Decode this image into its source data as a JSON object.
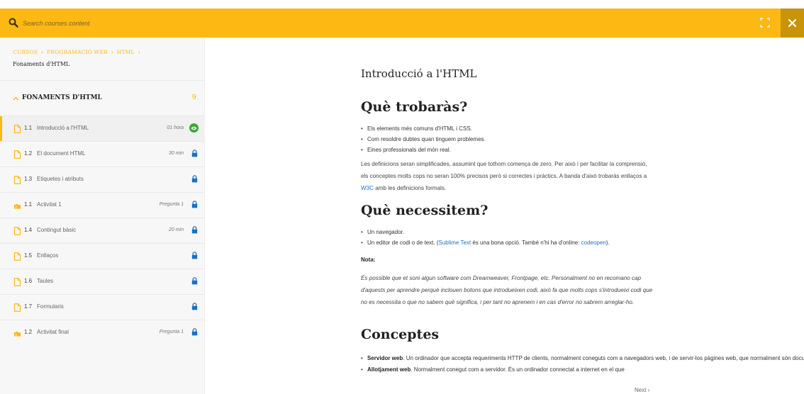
{
  "search": {
    "placeholder": "Search courses content"
  },
  "colors": {
    "accent": "#fdb813",
    "close_bg": "#c9930a",
    "complete": "#3aaa35",
    "link": "#1a73c8"
  },
  "breadcrumb": {
    "items": [
      "CURSOS",
      "PROGRAMACIÓ WEB",
      "HTML"
    ],
    "current": "Fonaments d'HTML"
  },
  "section": {
    "title": "FONAMENTS D'HTML",
    "count": "9"
  },
  "lessons": [
    {
      "type": "doc",
      "num": "1.1",
      "title": "Introducció a l'HTML",
      "meta": "01 hora",
      "status": "viewed",
      "active": true
    },
    {
      "type": "doc",
      "num": "1.2",
      "title": "El document HTML",
      "meta": "30 min",
      "status": "locked"
    },
    {
      "type": "doc",
      "num": "1.3",
      "title": "Etiquetes i atributs",
      "meta": "",
      "status": "locked"
    },
    {
      "type": "quiz",
      "num": "1.1",
      "title": "Activitat 1",
      "meta": "Pregunta 1",
      "status": "locked"
    },
    {
      "type": "doc",
      "num": "1.4",
      "title": "Contingut bàsic",
      "meta": "20 min",
      "status": "locked"
    },
    {
      "type": "doc",
      "num": "1.5",
      "title": "Enllaços",
      "meta": "",
      "status": "locked"
    },
    {
      "type": "doc",
      "num": "1.6",
      "title": "Taules",
      "meta": "",
      "status": "locked"
    },
    {
      "type": "doc",
      "num": "1.7",
      "title": "Formularis",
      "meta": "",
      "status": "locked"
    },
    {
      "type": "quiz",
      "num": "1.2",
      "title": "Activitat final",
      "meta": "Pregunta 1",
      "status": "locked"
    }
  ],
  "content": {
    "title": "Introducció a l'HTML",
    "h_find": "Què trobaràs?",
    "find_items": [
      "Els elements més comuns d'HTML i CSS.",
      "Com resoldre dubtes quan tinguem problemes.",
      "Eines professionals del món real."
    ],
    "find_para_1": "Les definicions seran simplificades, assumint que tothom comença de zero. Per això i per facilitar la comprensió, els conceptes molts cops no seran 100% precisos però si correctes i pràctics. A banda d'això trobaràs enllaços a ",
    "find_para_link": "W3C",
    "find_para_2": " amb les definicions formals.",
    "h_need": "Què necessitem?",
    "need_item_1": "Un navegador.",
    "need_item_2a": "Un editor de codi o de text. (",
    "need_item_2_link1": "Sublime Text",
    "need_item_2b": " és una bona opció. També n'hi ha d'online: ",
    "need_item_2_link2": "codeopen",
    "need_item_2c": ").",
    "nota_label": "Nota:",
    "nota_text": "És possible que et soni algun software com Dreamweaver, Frontpage, etc. Personalment no en recomano cap d'aquests per aprendre perquè inclouen botons que introdueixen codi, això fa que molts cops s'introdueixi codi que no es necessita o que no sabem què significa, i per tant no aprenem i en cas d'error no sabrem arreglar-ho.",
    "h_concepts": "Conceptes",
    "concept_1_term": "Servidor web",
    "concept_1_text": ". Un ordinador que accepta requeriments HTTP de clients, normalment coneguts com a navegadors web, i de servir-los pàgines web, que normalment són documents HTML.",
    "concept_2_term": "Allotjament web",
    "concept_2_text": ". Normalment conegut com a servidor. És un ordinador connectat a internet en el que"
  },
  "nav": {
    "next": "Next ›"
  }
}
